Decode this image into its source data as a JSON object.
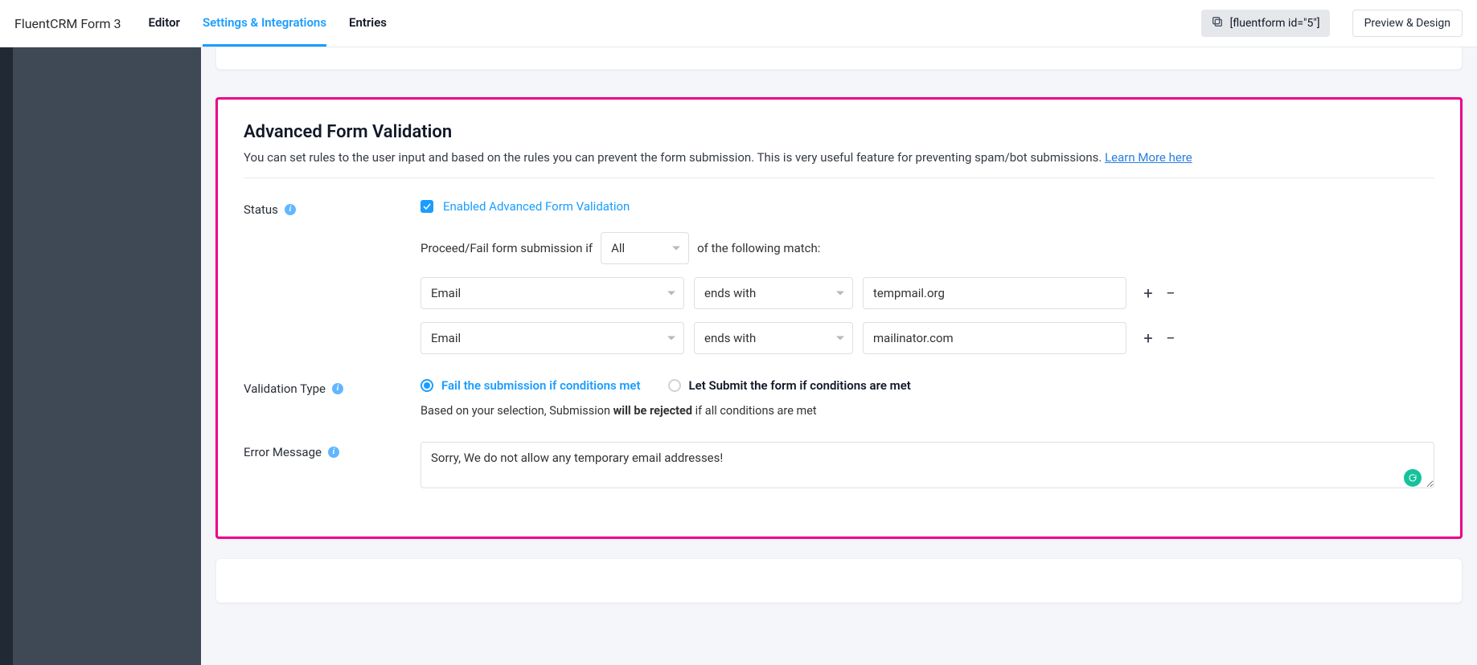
{
  "header": {
    "app_title": "FluentCRM Form 3",
    "tabs": [
      {
        "label": "Editor",
        "active": false
      },
      {
        "label": "Settings & Integrations",
        "active": true
      },
      {
        "label": "Entries",
        "active": false
      }
    ],
    "shortcode": "[fluentform id=\"5\"]",
    "preview_label": "Preview & Design"
  },
  "card": {
    "title": "Advanced Form Validation",
    "lead": "You can set rules to the user input and based on the rules you can prevent the form submission. This is very useful feature for preventing spam/bot submissions.",
    "learn_more": "Learn More here",
    "status": {
      "label": "Status",
      "checkbox_label": "Enabled Advanced Form Validation",
      "sentence_before": "Proceed/Fail form submission if",
      "match_mode": "All",
      "sentence_after": "of the following match:"
    },
    "rules": [
      {
        "field": "Email",
        "operator": "ends with",
        "value": "tempmail.org"
      },
      {
        "field": "Email",
        "operator": "ends with",
        "value": "mailinator.com"
      }
    ],
    "validation_type": {
      "label": "Validation Type",
      "options": [
        {
          "label": "Fail the submission if conditions met",
          "active": true
        },
        {
          "label": "Let Submit the form if conditions are met",
          "active": false
        }
      ],
      "help_before": "Based on your selection, Submission ",
      "help_strong": "will be rejected",
      "help_after": " if all conditions are met"
    },
    "error_message": {
      "label": "Error Message",
      "value": "Sorry, We do not allow any temporary email addresses!"
    }
  },
  "icons": {
    "plus": "+",
    "minus": "−"
  }
}
